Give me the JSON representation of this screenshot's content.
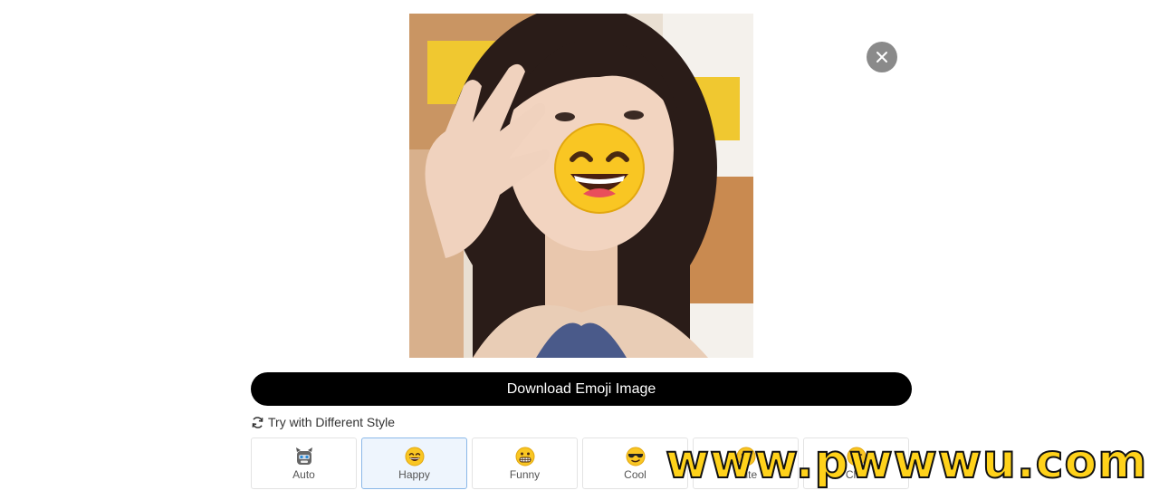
{
  "download_button": {
    "label": "Download Emoji Image"
  },
  "try_different": {
    "label": "Try with Different Style"
  },
  "styles": [
    {
      "label": "Auto",
      "icon": "robot-emoji-icon"
    },
    {
      "label": "Happy",
      "icon": "smiling-emoji-icon",
      "selected": true
    },
    {
      "label": "Funny",
      "icon": "grimacing-emoji-icon"
    },
    {
      "label": "Cool",
      "icon": "sunglasses-emoji-icon"
    },
    {
      "label": "Cute",
      "icon": "cute-emoji-icon"
    },
    {
      "label": "Chill",
      "icon": "chill-emoji-icon"
    }
  ],
  "watermark": {
    "text": "www.pwwwu.com"
  },
  "colors": {
    "primary_button": "#000000",
    "selected_card_bg": "#eef5fd",
    "selected_card_border": "#8bb8e8",
    "close_button": "#8a8a8a",
    "watermark": "#ffd21a"
  }
}
